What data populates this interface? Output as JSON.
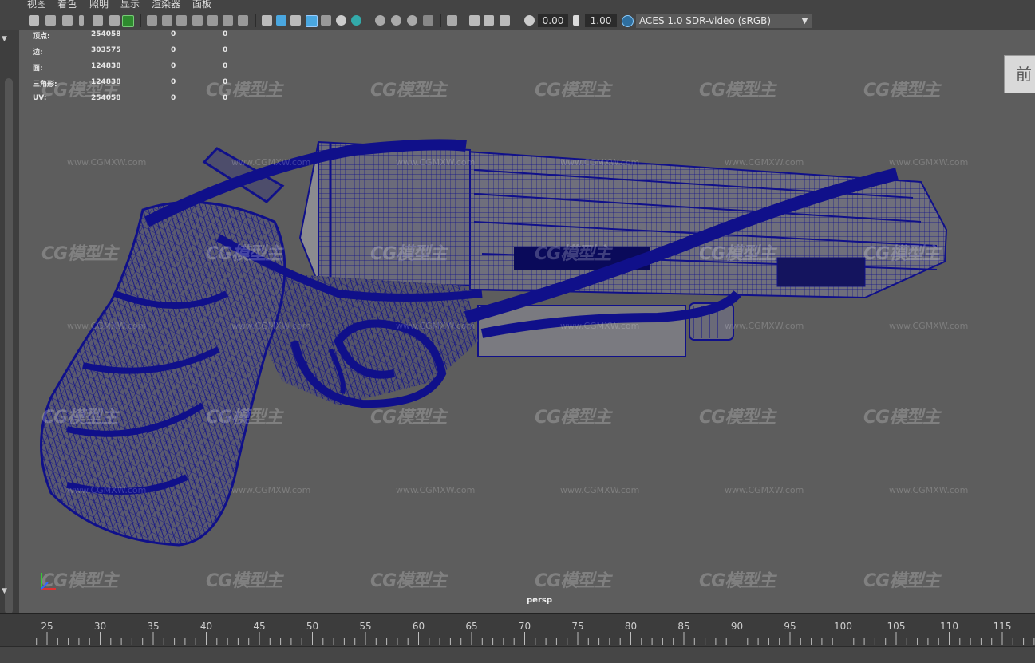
{
  "menu": [
    "视图",
    "着色",
    "照明",
    "显示",
    "渲染器",
    "面板"
  ],
  "toolbar": {
    "exposure": "0.00",
    "gamma": "1.00",
    "color_space": "ACES 1.0 SDR-video (sRGB)"
  },
  "hud": {
    "rows": [
      {
        "label": "顶点:",
        "count": "254058",
        "a": "0",
        "b": "0"
      },
      {
        "label": "边:",
        "count": "303575",
        "a": "0",
        "b": "0"
      },
      {
        "label": "面:",
        "count": "124838",
        "a": "0",
        "b": "0"
      },
      {
        "label": "三角形:",
        "count": "124838",
        "a": "0",
        "b": "0"
      },
      {
        "label": "UV:",
        "count": "254058",
        "a": "0",
        "b": "0"
      }
    ]
  },
  "viewport": {
    "camera": "persp",
    "viewcube_face": "前"
  },
  "watermark": {
    "logo": "CG模型主",
    "url": "www.CGMXW.com"
  },
  "timeline": {
    "ticks": [
      "25",
      "30",
      "35",
      "40",
      "45",
      "50",
      "55",
      "60",
      "65",
      "70",
      "75",
      "80",
      "85",
      "90",
      "95",
      "100",
      "105",
      "110",
      "115"
    ]
  },
  "colors": {
    "wire": "#10108a",
    "viewport_bg": "#5d5d5d",
    "accent": "#3a9ad9"
  }
}
